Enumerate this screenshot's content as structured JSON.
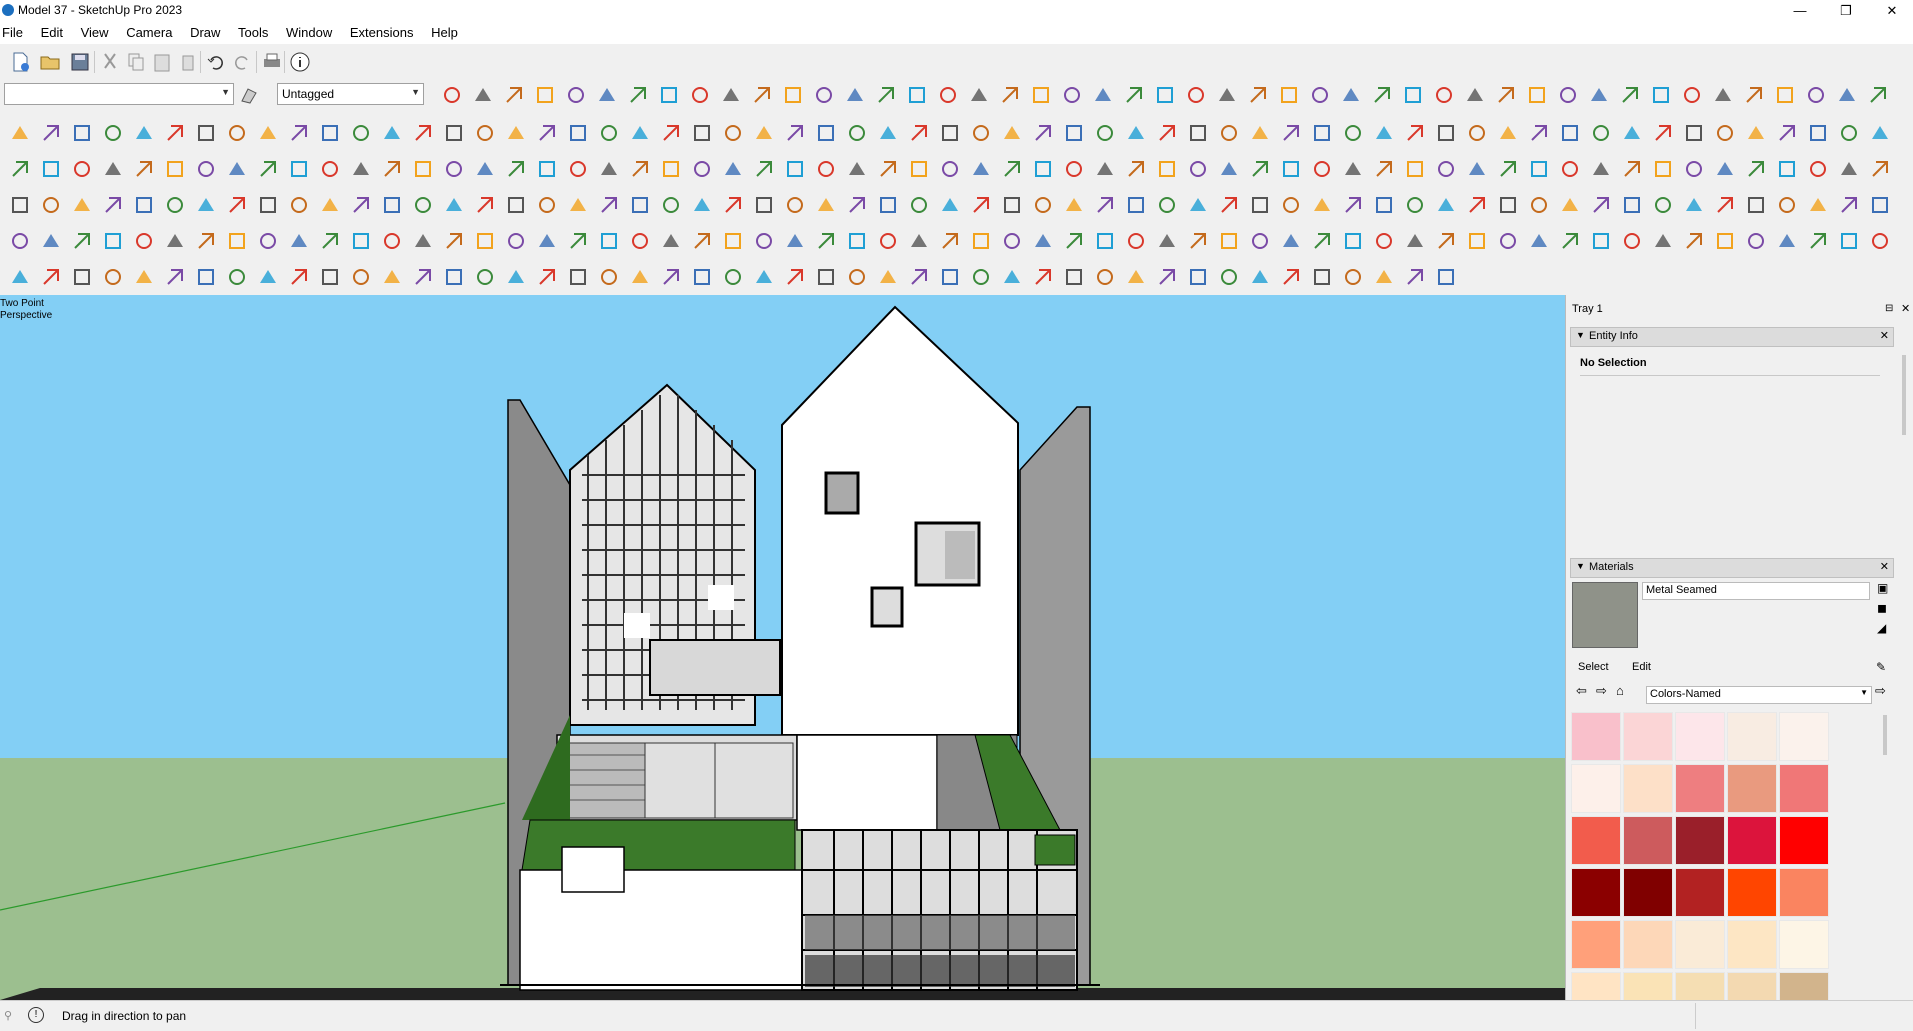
{
  "window": {
    "title": "Model 37 - SketchUp Pro 2023",
    "minimize": "—",
    "maximize": "❐",
    "close": "✕"
  },
  "menu": [
    "File",
    "Edit",
    "View",
    "Camera",
    "Draw",
    "Tools",
    "Window",
    "Extensions",
    "Help"
  ],
  "toolbar": {
    "tag_value": "Untagged",
    "style_value": ""
  },
  "viewport": {
    "camera_label_1": "Two Point",
    "camera_label_2": "Perspective"
  },
  "tray": {
    "title": "Tray 1",
    "entity_info": {
      "title": "Entity Info",
      "selection": "No Selection"
    },
    "materials": {
      "title": "Materials",
      "current": "Metal Seamed",
      "tabs": [
        "Select",
        "Edit"
      ],
      "library": "Colors-Named",
      "swatches": [
        "#f9c0cb",
        "#fbd5d6",
        "#fde6ea",
        "#f8ece2",
        "#fbf2ec",
        "#fdf0ea",
        "#fde0c8",
        "#ee7e80",
        "#e99a7f",
        "#f07777",
        "#f25c4c",
        "#cd5b5d",
        "#9a1f2a",
        "#dc143c",
        "#ff0000",
        "#8b0000",
        "#800000",
        "#b22222",
        "#ff4500",
        "#fa8460",
        "#ffa07a",
        "#fdd7b8",
        "#faebd7",
        "#fde6c4",
        "#fdf5e6",
        "#ffe4c4",
        "#fae3b6",
        "#f5deb3",
        "#f3d9b1",
        "#d2b48c"
      ]
    }
  },
  "status": {
    "message": "Drag in direction to pan"
  }
}
